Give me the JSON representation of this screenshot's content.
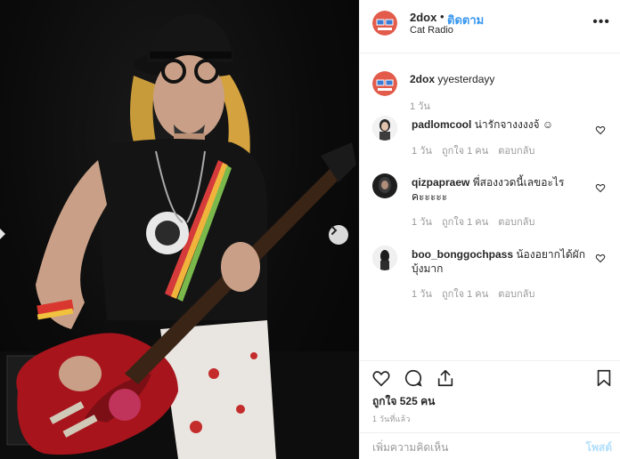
{
  "post": {
    "author": "2dox",
    "separator": "•",
    "follow_label": "ติดตาม",
    "location": "Cat Radio",
    "more_label": "•••"
  },
  "caption": {
    "username": "2dox",
    "text": "yyesterdayy",
    "time": "1 วัน"
  },
  "comments": [
    {
      "username": "padlomcool",
      "text": "น่ารักจางงงงจ้ ☺",
      "time": "1 วัน",
      "likes": "ถูกใจ 1 คน",
      "reply": "ตอบกลับ"
    },
    {
      "username": "qizpapraew",
      "text": "พี่สองงวดนี้เลขอะไร คะะะะะ",
      "time": "1 วัน",
      "likes": "ถูกใจ 1 คน",
      "reply": "ตอบกลับ"
    },
    {
      "username": "boo_bonggochpass",
      "text": "น้องอยากได้ผักบุ้งมาก",
      "time": "1 วัน",
      "likes": "ถูกใจ 1 คน",
      "reply": "ตอบกลับ"
    }
  ],
  "stats": {
    "likes": "ถูกใจ 525 คน",
    "timestamp": "1 วันที่แล้ว"
  },
  "composer": {
    "placeholder": "เพิ่มความคิดเห็น",
    "post_label": "โพสต์"
  },
  "icons": [
    "heart-icon",
    "comment-icon",
    "share-icon",
    "bookmark-icon",
    "chevron-right-icon",
    "more-icon"
  ],
  "colors": {
    "accent": "#3897f0",
    "text": "#262626",
    "muted": "#999999",
    "post_disabled": "#b2dffc"
  }
}
